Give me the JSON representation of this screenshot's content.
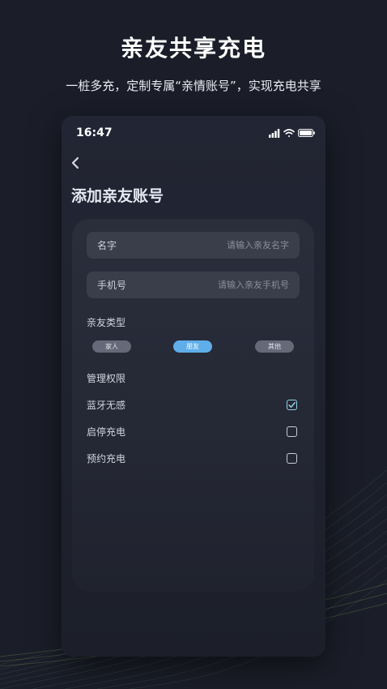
{
  "promo": {
    "headline": "亲友共享充电",
    "subline": "一桩多充，定制专属“亲情账号”，实现充电共享"
  },
  "status_bar": {
    "time": "16:47"
  },
  "page": {
    "title": "添加亲友账号"
  },
  "form": {
    "name_label": "名字",
    "name_placeholder": "请输入亲友名字",
    "name_value": "",
    "phone_label": "手机号",
    "phone_placeholder": "请输入亲友手机号",
    "phone_value": ""
  },
  "relation": {
    "title": "亲友类型",
    "options": [
      "家人",
      "朋友",
      "其他"
    ],
    "selected": "朋友"
  },
  "permissions": {
    "title": "管理权限",
    "items": [
      {
        "label": "蓝牙无感",
        "checked": true
      },
      {
        "label": "启停充电",
        "checked": false
      },
      {
        "label": "预约充电",
        "checked": false
      }
    ]
  },
  "colors": {
    "background": "#1b1e29",
    "card": "#282b38",
    "chip_active": "#5faee9",
    "chip_inactive": "#656a78",
    "check_accent": "#8fd3e8"
  }
}
